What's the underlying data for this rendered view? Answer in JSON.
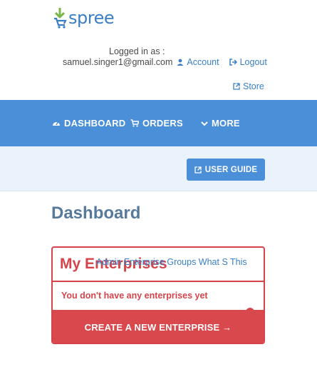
{
  "brand": {
    "logo_text": "spree"
  },
  "session": {
    "logged_in_label": "Logged in as :",
    "email": "samuel.singer1@gmail.com",
    "account_link": "Account",
    "logout_link": "Logout",
    "store_link": "Store"
  },
  "nav": {
    "items": [
      {
        "label": "DASHBOARD",
        "icon": "dashboard-icon"
      },
      {
        "label": "ORDERS",
        "icon": "cart-icon"
      },
      {
        "label": "MORE",
        "icon": "chevron-down-icon"
      }
    ]
  },
  "toolbar": {
    "user_guide_label": "USER GUIDE"
  },
  "main": {
    "title": "Dashboard",
    "enterprises_panel": {
      "title": "My Enterprises",
      "link": "Admin Enterprise Groups What S This",
      "empty_message": "You don't have any enterprises yet",
      "create_button": "CREATE A NEW ENTERPRISE →"
    }
  },
  "colors": {
    "accent_blue": "#4a8fd8",
    "link_blue": "#3a7fc6",
    "danger_red": "#d6444b",
    "subbar_bg": "#eaf2fb",
    "title_slate": "#577a9a"
  }
}
